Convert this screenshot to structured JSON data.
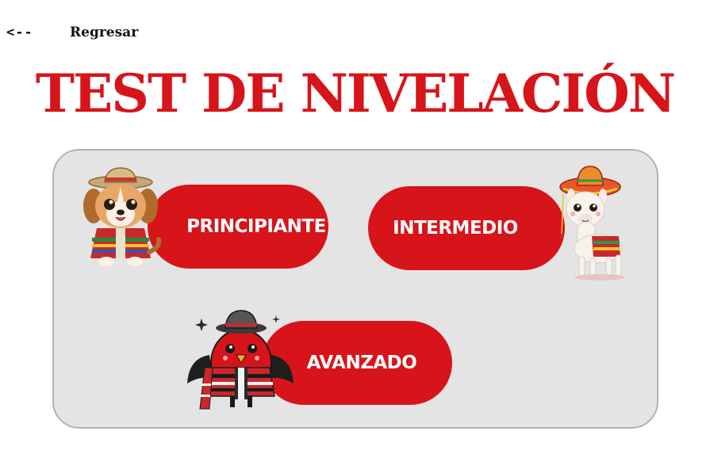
{
  "nav": {
    "back_arrow": "<--",
    "back_label": "Regresar"
  },
  "page_title": "TEST DE NIVELACIÓN",
  "levels": [
    {
      "label": "PRINCIPIANTE",
      "mascot_icon": "dog-mascot-icon"
    },
    {
      "label": "INTERMEDIO",
      "mascot_icon": "llama-mascot-icon"
    },
    {
      "label": "AVANZADO",
      "mascot_icon": "bird-mascot-icon"
    }
  ],
  "colors": {
    "accent": "#d7141a",
    "panel_bg": "#e4e4e4",
    "panel_border": "#b3b3b3"
  }
}
